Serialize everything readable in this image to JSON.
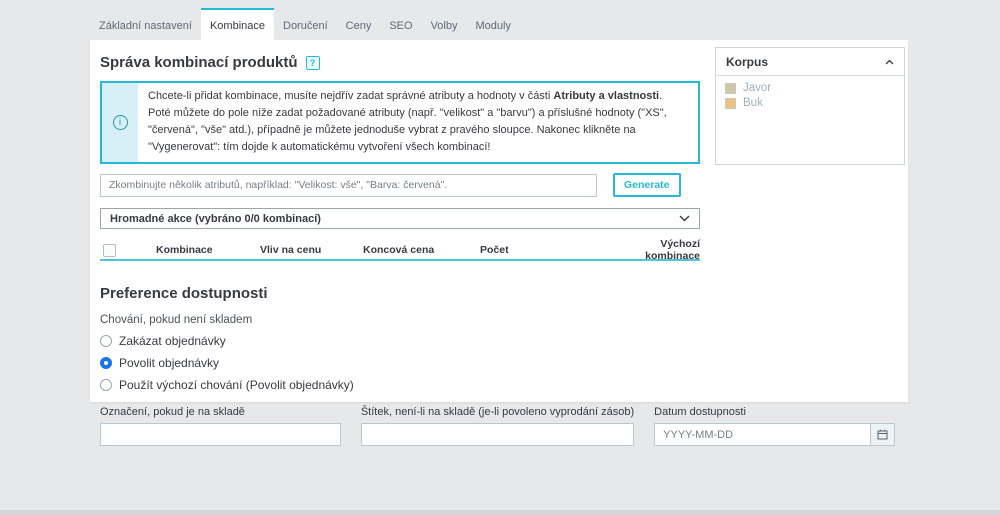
{
  "colors": {
    "accent_teal": "#25b9d7",
    "radio_selected_blue": "#1a73e8",
    "table_head_underline": "#4ec5db",
    "page_background": "#e6e8ea"
  },
  "tabs": [
    {
      "label": "Základní nastavení",
      "active": false
    },
    {
      "label": "Kombinace",
      "active": true
    },
    {
      "label": "Doručení",
      "active": false
    },
    {
      "label": "Ceny",
      "active": false
    },
    {
      "label": "SEO",
      "active": false
    },
    {
      "label": "Volby",
      "active": false
    },
    {
      "label": "Moduly",
      "active": false
    }
  ],
  "combinations": {
    "title": "Správa kombinací produktů",
    "help_icon": "?",
    "info_icon": "i",
    "info": {
      "line1_prefix": "Chcete-li přidat kombinace, musíte nejdřív zadat správné atributy a hodnoty v části ",
      "line1_bold": "Atributy a vlastnosti",
      "line1_suffix": ".",
      "line2": "Poté můžete do pole níže zadat požadované atributy (např. \"velikost\" a \"barvu\") a příslušné hodnoty (\"XS\", \"červená\", \"vše\" atd.), případně je můžete jednoduše vybrat z pravého sloupce. Nakonec klikněte na \"Vygenerovat\": tím dojde k automatickému vytvoření všech kombinací!"
    },
    "generator": {
      "value": "",
      "placeholder": "Zkombinujte několik atributů, například: \"Velikost: vše\", \"Barva: červená\".",
      "button_label": "Generate"
    },
    "bulk_actions_label": "Hromadné akce (vybráno 0/0 kombinací)",
    "table": {
      "columns": [
        "Kombinace",
        "Vliv na cenu",
        "Koncová cena",
        "Počet",
        "Výchozí kombinace"
      ]
    }
  },
  "availability": {
    "title": "Preference dostupnosti",
    "behavior_label": "Chování, pokud není skladem",
    "options": [
      {
        "label": "Zakázat objednávky",
        "selected": false
      },
      {
        "label": "Povolit objednávky",
        "selected": true
      },
      {
        "label": "Použít výchozí chování (Povolit objednávky)",
        "selected": false
      }
    ],
    "fields": [
      {
        "label": "Označení, pokud je na skladě",
        "value": "",
        "placeholder": ""
      },
      {
        "label": "Štítek, není-li na skladě (je-li povoleno vyprodání zásob)",
        "value": "",
        "placeholder": ""
      },
      {
        "label": "Datum dostupnosti",
        "value": "",
        "placeholder": "YYYY-MM-DD"
      }
    ]
  },
  "korpus": {
    "title": "Korpus",
    "items": [
      {
        "label": "Javor",
        "color": "#d1c7a4"
      },
      {
        "label": "Buk",
        "color": "#efc17d"
      }
    ]
  }
}
